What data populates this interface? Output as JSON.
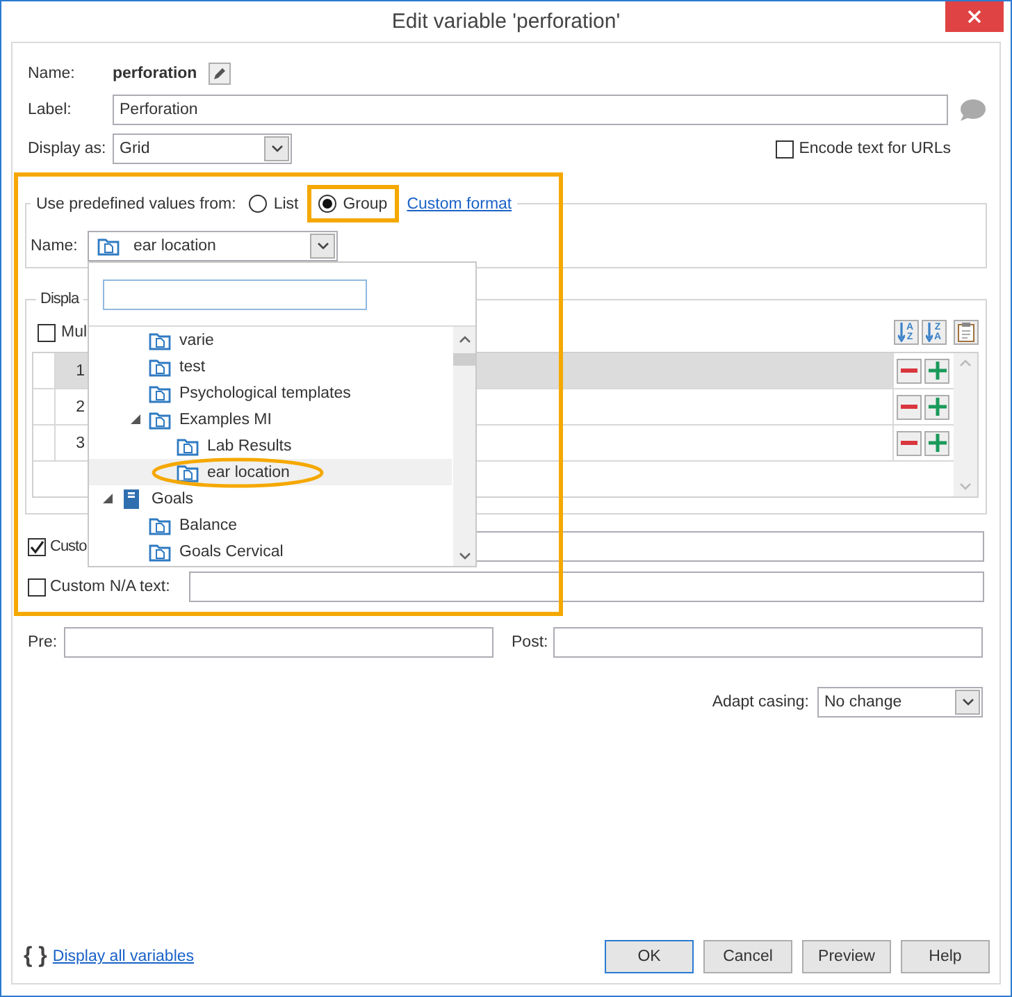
{
  "window": {
    "title": "Edit variable 'perforation'"
  },
  "name": {
    "label": "Name:",
    "value": "perforation"
  },
  "label_field": {
    "label": "Label:",
    "value": "Perforation"
  },
  "display_as": {
    "label": "Display as:",
    "value": "Grid"
  },
  "encode_urls": {
    "label": "Encode text for URLs",
    "checked": false
  },
  "predefined": {
    "highlighted": true,
    "legend": "Use predefined values from:",
    "options": [
      {
        "label": "List",
        "selected": false,
        "highlighted": false
      },
      {
        "label": "Group",
        "selected": true,
        "highlighted": true
      }
    ],
    "link": "Custom format",
    "name_label": "Name:",
    "name_value": "ear location"
  },
  "dropdown": {
    "tree": [
      {
        "children": [
          {
            "label": "varie",
            "kind": "folder",
            "selected": false
          },
          {
            "label": "test",
            "kind": "folder",
            "selected": false
          },
          {
            "label": "Psychological templates",
            "kind": "folder",
            "selected": false
          },
          {
            "label": "Examples MI",
            "kind": "folder",
            "selected": false,
            "expanded": true,
            "children": [
              {
                "label": "Lab Results",
                "kind": "folder",
                "selected": false
              },
              {
                "label": "ear location",
                "kind": "folder",
                "selected": true,
                "highlighted": true
              }
            ]
          }
        ]
      },
      {
        "label": "Goals",
        "kind": "book",
        "selected": false,
        "expanded": true,
        "children": [
          {
            "label": "Balance",
            "kind": "folder",
            "selected": false
          },
          {
            "label": "Goals Cervical",
            "kind": "folder",
            "selected": false
          }
        ]
      }
    ]
  },
  "display_group": {
    "legend": "Displa",
    "multi": {
      "label": "Mul",
      "checked": false
    },
    "sort_buttons": [
      {
        "top": "A",
        "bottom": "Z"
      },
      {
        "top": "Z",
        "bottom": "A"
      }
    ],
    "rows": [
      {
        "number": "1",
        "selected": true
      },
      {
        "number": "2",
        "selected": false
      },
      {
        "number": "3",
        "selected": false
      }
    ]
  },
  "custom_text": {
    "label": "Custo",
    "checked": true
  },
  "custom_na": {
    "label": "Custom N/A text:",
    "checked": false
  },
  "pre": {
    "label": "Pre:"
  },
  "post": {
    "label": "Post:"
  },
  "adapt_casing": {
    "label": "Adapt casing:",
    "value": "No change"
  },
  "footer": {
    "icon": "{ }",
    "link": "Display all variables",
    "buttons": [
      {
        "label": "OK",
        "default": true
      },
      {
        "label": "Cancel",
        "default": false
      },
      {
        "label": "Preview",
        "default": false
      },
      {
        "label": "Help",
        "default": false
      }
    ]
  }
}
